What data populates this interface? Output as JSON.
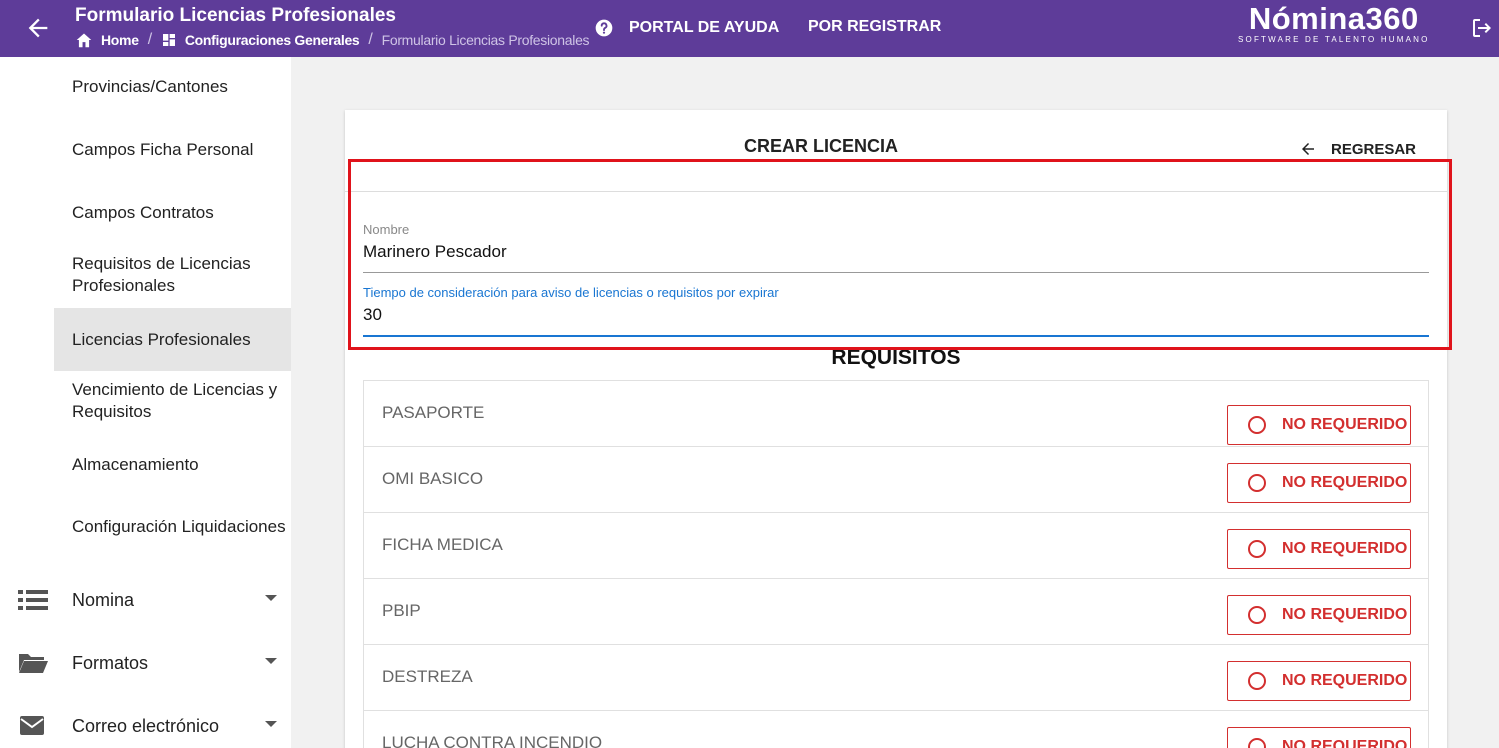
{
  "header": {
    "title": "Formulario Licencias Profesionales",
    "breadcrumb": {
      "home": "Home",
      "config": "Configuraciones Generales",
      "current": "Formulario Licencias Profesionales"
    },
    "help_label": "PORTAL DE AYUDA",
    "register_label": "POR REGISTRAR",
    "logo_main": "Nómina360",
    "logo_sub": "SOFTWARE DE TALENTO HUMANO"
  },
  "sidebar": {
    "sub_items": [
      {
        "label": "Provincias/Cantones"
      },
      {
        "label": "Campos Ficha Personal"
      },
      {
        "label": "Campos Contratos"
      },
      {
        "label": "Requisitos de Licencias Profesionales"
      },
      {
        "label": "Licencias Profesionales",
        "active": true
      },
      {
        "label": "Vencimiento de Licencias y Requisitos"
      },
      {
        "label": "Almacenamiento"
      },
      {
        "label": "Configuración Liquidaciones"
      }
    ],
    "main_items": [
      {
        "label": "Nomina",
        "icon": "list-icon"
      },
      {
        "label": "Formatos",
        "icon": "folder-icon"
      },
      {
        "label": "Correo electrónico",
        "icon": "mail-icon"
      }
    ]
  },
  "form": {
    "title": "CREAR LICENCIA",
    "back_label": "REGRESAR",
    "name_label": "Nombre",
    "name_value": "Marinero Pescador",
    "time_label": "Tiempo de consideración para aviso de licencias o requisitos por expirar",
    "time_value": "30"
  },
  "requirements": {
    "title": "REQUISITOS",
    "button_label": "NO REQUERIDO",
    "items": [
      "PASAPORTE",
      "OMI BASICO",
      "FICHA MEDICA",
      "PBIP",
      "DESTREZA",
      "LUCHA CONTRA INCENDIO"
    ]
  },
  "colors": {
    "header_bg": "#5e3c99",
    "accent_blue": "#1976d2",
    "danger_red": "#d32f2f",
    "highlight_red": "#e0131b"
  }
}
